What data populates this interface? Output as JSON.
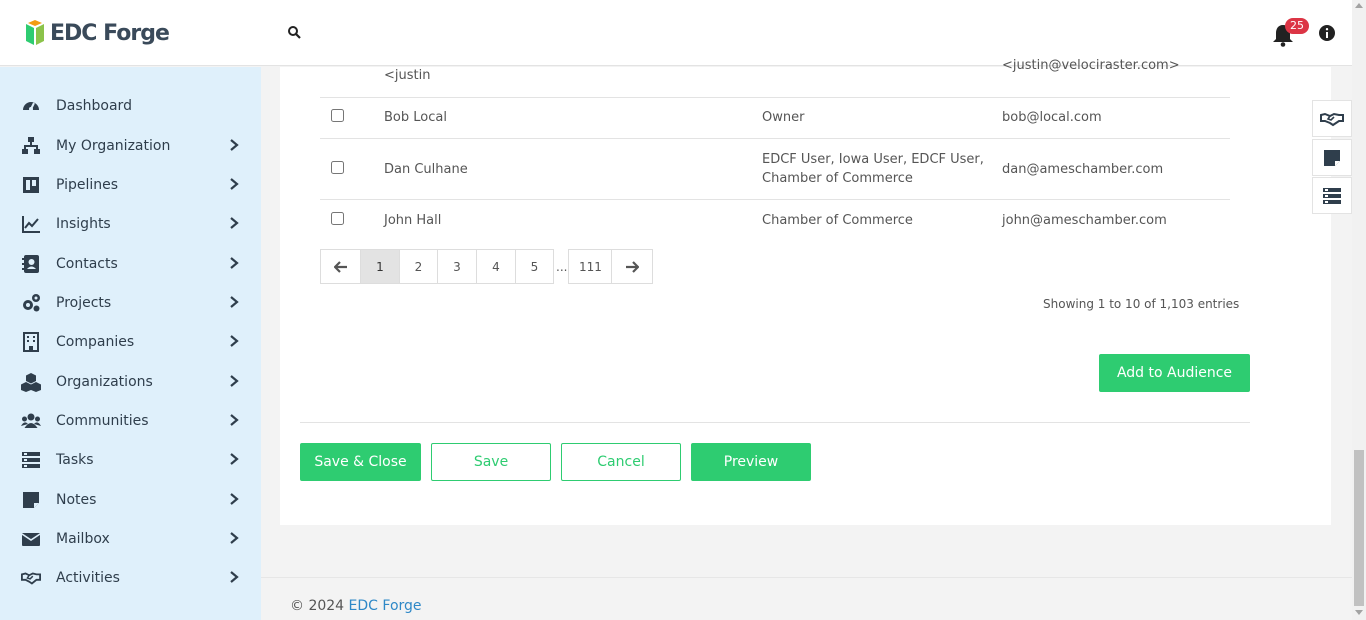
{
  "brand": {
    "name": "EDC Forge"
  },
  "header": {
    "notification_count": "25"
  },
  "sidebar": {
    "items": [
      {
        "label": "Dashboard",
        "icon": "dashboard-icon"
      },
      {
        "label": "My Organization",
        "icon": "sitemap-icon"
      },
      {
        "label": "Pipelines",
        "icon": "pipeline-icon"
      },
      {
        "label": "Insights",
        "icon": "chart-line-icon"
      },
      {
        "label": "Contacts",
        "icon": "contact-card-icon"
      },
      {
        "label": "Projects",
        "icon": "cogs-icon"
      },
      {
        "label": "Companies",
        "icon": "building-icon"
      },
      {
        "label": "Organizations",
        "icon": "cubes-icon"
      },
      {
        "label": "Communities",
        "icon": "users-icon"
      },
      {
        "label": "Tasks",
        "icon": "tasks-icon"
      },
      {
        "label": "Notes",
        "icon": "note-icon"
      },
      {
        "label": "Mailbox",
        "icon": "envelope-icon"
      },
      {
        "label": "Activities",
        "icon": "handshake-icon"
      }
    ]
  },
  "table": {
    "partial_row": {
      "name": "<justin",
      "email": "<justin@velociraster.com>"
    },
    "rows": [
      {
        "name": "Bob Local",
        "role": "Owner",
        "email": "bob@local.com"
      },
      {
        "name": "Dan Culhane",
        "role_line1": "EDCF User, Iowa User, EDCF User,",
        "role_line2": "Chamber of Commerce",
        "email": "dan@ameschamber.com"
      },
      {
        "name": "John Hall",
        "role": "Chamber of Commerce",
        "email": "john@ameschamber.com"
      }
    ]
  },
  "pagination": {
    "pages": [
      "1",
      "2",
      "3",
      "4",
      "5"
    ],
    "ellipsis": "...",
    "last": "111",
    "current": "1"
  },
  "entries_info": "Showing 1 to 10 of 1,103 entries",
  "actions": {
    "add_to_audience": "Add to Audience",
    "save_close": "Save & Close",
    "save": "Save",
    "cancel": "Cancel",
    "preview": "Preview"
  },
  "footer": {
    "copyright": "© 2024",
    "link": "EDC Forge"
  },
  "colors": {
    "accent": "#2ecc71",
    "sidebar_bg": "#dff0fb",
    "badge": "#dc3545",
    "link": "#2e88c7"
  }
}
